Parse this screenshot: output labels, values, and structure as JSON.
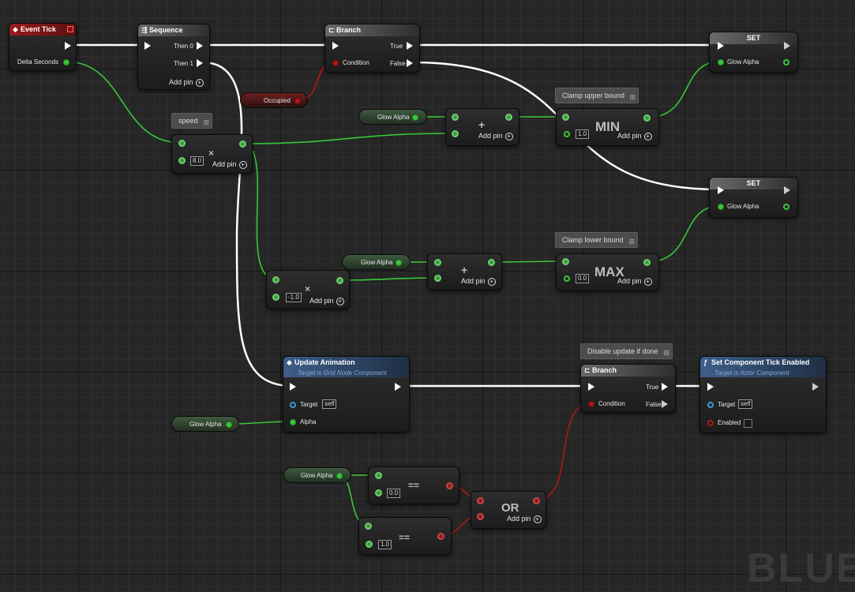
{
  "event_tick": {
    "title": "Event Tick",
    "delta_label": "Delta Seconds"
  },
  "sequence": {
    "title": "Sequence",
    "then0": "Then 0",
    "then1": "Then 1",
    "add_pin": "Add pin"
  },
  "branch1": {
    "title": "Branch",
    "true_label": "True",
    "false_label": "False",
    "condition": "Condition"
  },
  "set1": {
    "title": "SET",
    "var": "Glow Alpha"
  },
  "set2": {
    "title": "SET",
    "var": "Glow Alpha"
  },
  "occupied": {
    "label": "Occupied"
  },
  "speed_comment": "speed",
  "multiply1": {
    "symbol": "×",
    "value": "8.0",
    "add_pin": "Add pin"
  },
  "glow_get1": "Glow Alpha",
  "add1": {
    "symbol": "+",
    "add_pin": "Add pin"
  },
  "clamp_upper_comment": "Clamp upper bound",
  "min_node": {
    "label": "MIN",
    "value": "1.0",
    "add_pin": "Add pin"
  },
  "multiply2": {
    "symbol": "×",
    "value": "-1.0",
    "add_pin": "Add pin"
  },
  "glow_get2": "Glow Alpha",
  "add2": {
    "symbol": "+",
    "add_pin": "Add pin"
  },
  "clamp_lower_comment": "Clamp lower bound",
  "max_node": {
    "label": "MAX",
    "value": "0.0",
    "add_pin": "Add pin"
  },
  "update_anim": {
    "title": "Update Animation",
    "subtitle": "Target is Grid Node Component",
    "target": "Target",
    "self": "self",
    "alpha": "Alpha"
  },
  "glow_get3": "Glow Alpha",
  "disable_comment": "Disable update if done",
  "branch2": {
    "title": "Branch",
    "true_label": "True",
    "false_label": "False",
    "condition": "Condition"
  },
  "set_tick": {
    "title": "Set Component Tick Enabled",
    "subtitle": "Target is Actor Component",
    "target": "Target",
    "self": "self",
    "enabled": "Enabled"
  },
  "glow_get4": "Glow Alpha",
  "eq1": {
    "symbol": "==",
    "value": "0.0"
  },
  "eq2": {
    "symbol": "==",
    "value": "1.0"
  },
  "or_node": {
    "label": "OR",
    "add_pin": "Add pin"
  },
  "watermark": "BLUE",
  "colors": {
    "exec": "#ffffff",
    "float": "#38c838",
    "bool": "#b01818",
    "object": "#3a9ad8"
  }
}
